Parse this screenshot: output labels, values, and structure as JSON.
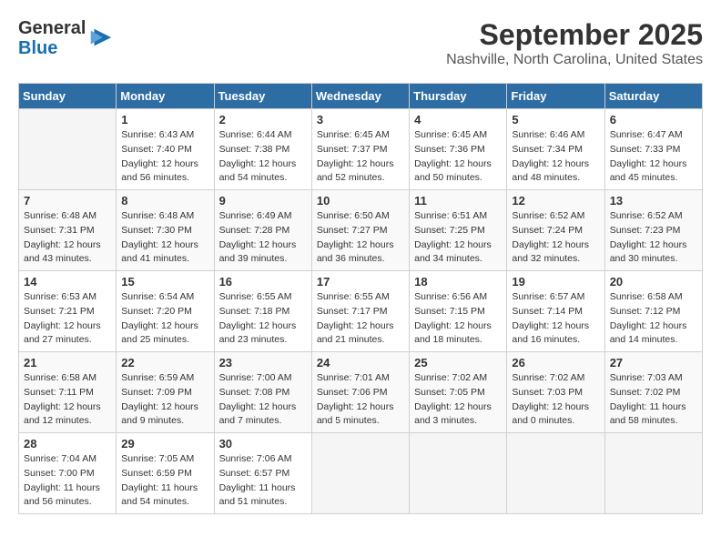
{
  "header": {
    "logo": {
      "line1": "General",
      "line2": "Blue"
    },
    "title": "September 2025",
    "subtitle": "Nashville, North Carolina, United States"
  },
  "weekdays": [
    "Sunday",
    "Monday",
    "Tuesday",
    "Wednesday",
    "Thursday",
    "Friday",
    "Saturday"
  ],
  "weeks": [
    [
      {
        "day": null
      },
      {
        "day": "1",
        "sunrise": "6:43 AM",
        "sunset": "7:40 PM",
        "daylight": "12 hours and 56 minutes."
      },
      {
        "day": "2",
        "sunrise": "6:44 AM",
        "sunset": "7:38 PM",
        "daylight": "12 hours and 54 minutes."
      },
      {
        "day": "3",
        "sunrise": "6:45 AM",
        "sunset": "7:37 PM",
        "daylight": "12 hours and 52 minutes."
      },
      {
        "day": "4",
        "sunrise": "6:45 AM",
        "sunset": "7:36 PM",
        "daylight": "12 hours and 50 minutes."
      },
      {
        "day": "5",
        "sunrise": "6:46 AM",
        "sunset": "7:34 PM",
        "daylight": "12 hours and 48 minutes."
      },
      {
        "day": "6",
        "sunrise": "6:47 AM",
        "sunset": "7:33 PM",
        "daylight": "12 hours and 45 minutes."
      }
    ],
    [
      {
        "day": "7",
        "sunrise": "6:48 AM",
        "sunset": "7:31 PM",
        "daylight": "12 hours and 43 minutes."
      },
      {
        "day": "8",
        "sunrise": "6:48 AM",
        "sunset": "7:30 PM",
        "daylight": "12 hours and 41 minutes."
      },
      {
        "day": "9",
        "sunrise": "6:49 AM",
        "sunset": "7:28 PM",
        "daylight": "12 hours and 39 minutes."
      },
      {
        "day": "10",
        "sunrise": "6:50 AM",
        "sunset": "7:27 PM",
        "daylight": "12 hours and 36 minutes."
      },
      {
        "day": "11",
        "sunrise": "6:51 AM",
        "sunset": "7:25 PM",
        "daylight": "12 hours and 34 minutes."
      },
      {
        "day": "12",
        "sunrise": "6:52 AM",
        "sunset": "7:24 PM",
        "daylight": "12 hours and 32 minutes."
      },
      {
        "day": "13",
        "sunrise": "6:52 AM",
        "sunset": "7:23 PM",
        "daylight": "12 hours and 30 minutes."
      }
    ],
    [
      {
        "day": "14",
        "sunrise": "6:53 AM",
        "sunset": "7:21 PM",
        "daylight": "12 hours and 27 minutes."
      },
      {
        "day": "15",
        "sunrise": "6:54 AM",
        "sunset": "7:20 PM",
        "daylight": "12 hours and 25 minutes."
      },
      {
        "day": "16",
        "sunrise": "6:55 AM",
        "sunset": "7:18 PM",
        "daylight": "12 hours and 23 minutes."
      },
      {
        "day": "17",
        "sunrise": "6:55 AM",
        "sunset": "7:17 PM",
        "daylight": "12 hours and 21 minutes."
      },
      {
        "day": "18",
        "sunrise": "6:56 AM",
        "sunset": "7:15 PM",
        "daylight": "12 hours and 18 minutes."
      },
      {
        "day": "19",
        "sunrise": "6:57 AM",
        "sunset": "7:14 PM",
        "daylight": "12 hours and 16 minutes."
      },
      {
        "day": "20",
        "sunrise": "6:58 AM",
        "sunset": "7:12 PM",
        "daylight": "12 hours and 14 minutes."
      }
    ],
    [
      {
        "day": "21",
        "sunrise": "6:58 AM",
        "sunset": "7:11 PM",
        "daylight": "12 hours and 12 minutes."
      },
      {
        "day": "22",
        "sunrise": "6:59 AM",
        "sunset": "7:09 PM",
        "daylight": "12 hours and 9 minutes."
      },
      {
        "day": "23",
        "sunrise": "7:00 AM",
        "sunset": "7:08 PM",
        "daylight": "12 hours and 7 minutes."
      },
      {
        "day": "24",
        "sunrise": "7:01 AM",
        "sunset": "7:06 PM",
        "daylight": "12 hours and 5 minutes."
      },
      {
        "day": "25",
        "sunrise": "7:02 AM",
        "sunset": "7:05 PM",
        "daylight": "12 hours and 3 minutes."
      },
      {
        "day": "26",
        "sunrise": "7:02 AM",
        "sunset": "7:03 PM",
        "daylight": "12 hours and 0 minutes."
      },
      {
        "day": "27",
        "sunrise": "7:03 AM",
        "sunset": "7:02 PM",
        "daylight": "11 hours and 58 minutes."
      }
    ],
    [
      {
        "day": "28",
        "sunrise": "7:04 AM",
        "sunset": "7:00 PM",
        "daylight": "11 hours and 56 minutes."
      },
      {
        "day": "29",
        "sunrise": "7:05 AM",
        "sunset": "6:59 PM",
        "daylight": "11 hours and 54 minutes."
      },
      {
        "day": "30",
        "sunrise": "7:06 AM",
        "sunset": "6:57 PM",
        "daylight": "11 hours and 51 minutes."
      },
      {
        "day": null
      },
      {
        "day": null
      },
      {
        "day": null
      },
      {
        "day": null
      }
    ]
  ]
}
